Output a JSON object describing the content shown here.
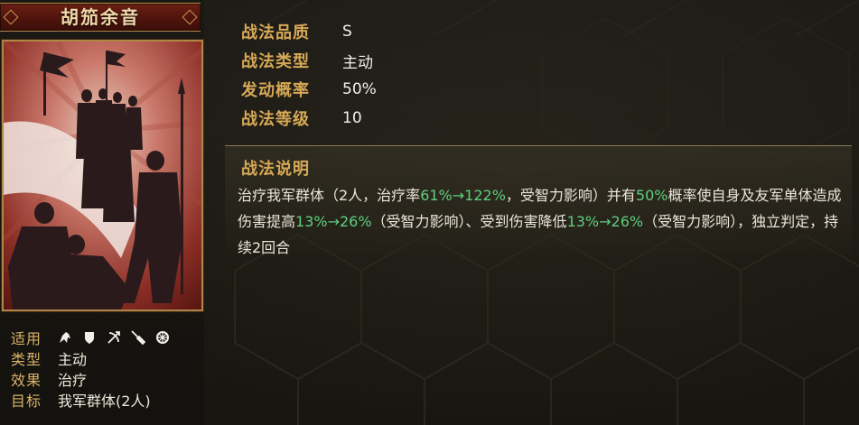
{
  "skill": {
    "name": "胡笳余音",
    "attributes": [
      {
        "label": "战法品质",
        "value": "S"
      },
      {
        "label": "战法类型",
        "value": "主动"
      },
      {
        "label": "发动概率",
        "value": "50%"
      },
      {
        "label": "战法等级",
        "value": "10"
      }
    ],
    "description": {
      "title": "战法说明",
      "segments": [
        {
          "text": "治疗我军群体（2人，治疗率",
          "highlight": false
        },
        {
          "text": "61%→122%",
          "highlight": true
        },
        {
          "text": "，受智力影响）并有",
          "highlight": false
        },
        {
          "text": "50%",
          "highlight": true
        },
        {
          "text": "概率使自身及友军单体造成伤害提高",
          "highlight": false
        },
        {
          "text": "13%→26%",
          "highlight": true
        },
        {
          "text": "（受智力影响）、受到伤害降低",
          "highlight": false
        },
        {
          "text": "13%→26%",
          "highlight": true
        },
        {
          "text": "（受智力影响），独立判定，持续2回合",
          "highlight": false
        }
      ]
    }
  },
  "card_info": {
    "applicable_label": "适用",
    "troop_icons": [
      "cavalry-icon",
      "shield-icon",
      "archer-icon",
      "spear-icon",
      "siege-icon"
    ],
    "type_label": "类型",
    "type_value": "主动",
    "effect_label": "效果",
    "effect_value": "治疗",
    "target_label": "目标",
    "target_value": "我军群体(2人)"
  },
  "colors": {
    "accent_gold": "#d7a956",
    "highlight_green": "#5fcf7c",
    "title_red": "#5a1810",
    "text_light": "#ece6d8"
  }
}
